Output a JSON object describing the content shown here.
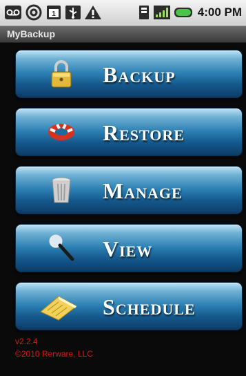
{
  "status_bar": {
    "time": "4:00 PM",
    "left_icons": [
      "voicemail-icon",
      "at-sign-icon",
      "calendar-icon",
      "usb-icon",
      "warning-icon"
    ],
    "right_icons": [
      "sd-card-icon",
      "signal-icon",
      "battery-icon"
    ]
  },
  "app": {
    "title": "MyBackup"
  },
  "menu": {
    "items": [
      {
        "label": "Backup",
        "icon": "padlock-icon"
      },
      {
        "label": "Restore",
        "icon": "life-ring-icon"
      },
      {
        "label": "Manage",
        "icon": "trash-can-icon"
      },
      {
        "label": "View",
        "icon": "magnifying-glass-icon"
      },
      {
        "label": "Schedule",
        "icon": "calendar-book-icon"
      }
    ]
  },
  "footer": {
    "version": "v2.2.4",
    "copyright": "©2010 Rerware, LLC"
  },
  "colors": {
    "button_blue": "#2c80b4",
    "footer_red": "#d81818",
    "background": "#0a0a0a"
  }
}
